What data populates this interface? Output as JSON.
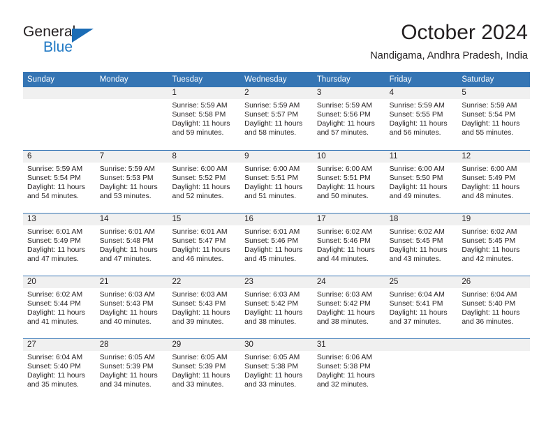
{
  "brand": {
    "name_top": "General",
    "name_bottom": "Blue",
    "triangle_color": "#1b6cb5",
    "blue_color": "#2079c4"
  },
  "header": {
    "title": "October 2024",
    "subtitle": "Nandigama, Andhra Pradesh, India"
  },
  "theme": {
    "header_row_bg": "#3575b4",
    "day_number_bg": "#f0f0f0",
    "text_color": "#231f20",
    "page_bg": "#ffffff"
  },
  "calendar": {
    "weekday_headers": [
      "Sunday",
      "Monday",
      "Tuesday",
      "Wednesday",
      "Thursday",
      "Friday",
      "Saturday"
    ],
    "weeks": [
      [
        {
          "day": "",
          "sunrise": "",
          "sunset": "",
          "daylight_line1": "",
          "daylight_line2": ""
        },
        {
          "day": "",
          "sunrise": "",
          "sunset": "",
          "daylight_line1": "",
          "daylight_line2": ""
        },
        {
          "day": "1",
          "sunrise": "Sunrise: 5:59 AM",
          "sunset": "Sunset: 5:58 PM",
          "daylight_line1": "Daylight: 11 hours",
          "daylight_line2": "and 59 minutes."
        },
        {
          "day": "2",
          "sunrise": "Sunrise: 5:59 AM",
          "sunset": "Sunset: 5:57 PM",
          "daylight_line1": "Daylight: 11 hours",
          "daylight_line2": "and 58 minutes."
        },
        {
          "day": "3",
          "sunrise": "Sunrise: 5:59 AM",
          "sunset": "Sunset: 5:56 PM",
          "daylight_line1": "Daylight: 11 hours",
          "daylight_line2": "and 57 minutes."
        },
        {
          "day": "4",
          "sunrise": "Sunrise: 5:59 AM",
          "sunset": "Sunset: 5:55 PM",
          "daylight_line1": "Daylight: 11 hours",
          "daylight_line2": "and 56 minutes."
        },
        {
          "day": "5",
          "sunrise": "Sunrise: 5:59 AM",
          "sunset": "Sunset: 5:54 PM",
          "daylight_line1": "Daylight: 11 hours",
          "daylight_line2": "and 55 minutes."
        }
      ],
      [
        {
          "day": "6",
          "sunrise": "Sunrise: 5:59 AM",
          "sunset": "Sunset: 5:54 PM",
          "daylight_line1": "Daylight: 11 hours",
          "daylight_line2": "and 54 minutes."
        },
        {
          "day": "7",
          "sunrise": "Sunrise: 5:59 AM",
          "sunset": "Sunset: 5:53 PM",
          "daylight_line1": "Daylight: 11 hours",
          "daylight_line2": "and 53 minutes."
        },
        {
          "day": "8",
          "sunrise": "Sunrise: 6:00 AM",
          "sunset": "Sunset: 5:52 PM",
          "daylight_line1": "Daylight: 11 hours",
          "daylight_line2": "and 52 minutes."
        },
        {
          "day": "9",
          "sunrise": "Sunrise: 6:00 AM",
          "sunset": "Sunset: 5:51 PM",
          "daylight_line1": "Daylight: 11 hours",
          "daylight_line2": "and 51 minutes."
        },
        {
          "day": "10",
          "sunrise": "Sunrise: 6:00 AM",
          "sunset": "Sunset: 5:51 PM",
          "daylight_line1": "Daylight: 11 hours",
          "daylight_line2": "and 50 minutes."
        },
        {
          "day": "11",
          "sunrise": "Sunrise: 6:00 AM",
          "sunset": "Sunset: 5:50 PM",
          "daylight_line1": "Daylight: 11 hours",
          "daylight_line2": "and 49 minutes."
        },
        {
          "day": "12",
          "sunrise": "Sunrise: 6:00 AM",
          "sunset": "Sunset: 5:49 PM",
          "daylight_line1": "Daylight: 11 hours",
          "daylight_line2": "and 48 minutes."
        }
      ],
      [
        {
          "day": "13",
          "sunrise": "Sunrise: 6:01 AM",
          "sunset": "Sunset: 5:49 PM",
          "daylight_line1": "Daylight: 11 hours",
          "daylight_line2": "and 47 minutes."
        },
        {
          "day": "14",
          "sunrise": "Sunrise: 6:01 AM",
          "sunset": "Sunset: 5:48 PM",
          "daylight_line1": "Daylight: 11 hours",
          "daylight_line2": "and 47 minutes."
        },
        {
          "day": "15",
          "sunrise": "Sunrise: 6:01 AM",
          "sunset": "Sunset: 5:47 PM",
          "daylight_line1": "Daylight: 11 hours",
          "daylight_line2": "and 46 minutes."
        },
        {
          "day": "16",
          "sunrise": "Sunrise: 6:01 AM",
          "sunset": "Sunset: 5:46 PM",
          "daylight_line1": "Daylight: 11 hours",
          "daylight_line2": "and 45 minutes."
        },
        {
          "day": "17",
          "sunrise": "Sunrise: 6:02 AM",
          "sunset": "Sunset: 5:46 PM",
          "daylight_line1": "Daylight: 11 hours",
          "daylight_line2": "and 44 minutes."
        },
        {
          "day": "18",
          "sunrise": "Sunrise: 6:02 AM",
          "sunset": "Sunset: 5:45 PM",
          "daylight_line1": "Daylight: 11 hours",
          "daylight_line2": "and 43 minutes."
        },
        {
          "day": "19",
          "sunrise": "Sunrise: 6:02 AM",
          "sunset": "Sunset: 5:45 PM",
          "daylight_line1": "Daylight: 11 hours",
          "daylight_line2": "and 42 minutes."
        }
      ],
      [
        {
          "day": "20",
          "sunrise": "Sunrise: 6:02 AM",
          "sunset": "Sunset: 5:44 PM",
          "daylight_line1": "Daylight: 11 hours",
          "daylight_line2": "and 41 minutes."
        },
        {
          "day": "21",
          "sunrise": "Sunrise: 6:03 AM",
          "sunset": "Sunset: 5:43 PM",
          "daylight_line1": "Daylight: 11 hours",
          "daylight_line2": "and 40 minutes."
        },
        {
          "day": "22",
          "sunrise": "Sunrise: 6:03 AM",
          "sunset": "Sunset: 5:43 PM",
          "daylight_line1": "Daylight: 11 hours",
          "daylight_line2": "and 39 minutes."
        },
        {
          "day": "23",
          "sunrise": "Sunrise: 6:03 AM",
          "sunset": "Sunset: 5:42 PM",
          "daylight_line1": "Daylight: 11 hours",
          "daylight_line2": "and 38 minutes."
        },
        {
          "day": "24",
          "sunrise": "Sunrise: 6:03 AM",
          "sunset": "Sunset: 5:42 PM",
          "daylight_line1": "Daylight: 11 hours",
          "daylight_line2": "and 38 minutes."
        },
        {
          "day": "25",
          "sunrise": "Sunrise: 6:04 AM",
          "sunset": "Sunset: 5:41 PM",
          "daylight_line1": "Daylight: 11 hours",
          "daylight_line2": "and 37 minutes."
        },
        {
          "day": "26",
          "sunrise": "Sunrise: 6:04 AM",
          "sunset": "Sunset: 5:40 PM",
          "daylight_line1": "Daylight: 11 hours",
          "daylight_line2": "and 36 minutes."
        }
      ],
      [
        {
          "day": "27",
          "sunrise": "Sunrise: 6:04 AM",
          "sunset": "Sunset: 5:40 PM",
          "daylight_line1": "Daylight: 11 hours",
          "daylight_line2": "and 35 minutes."
        },
        {
          "day": "28",
          "sunrise": "Sunrise: 6:05 AM",
          "sunset": "Sunset: 5:39 PM",
          "daylight_line1": "Daylight: 11 hours",
          "daylight_line2": "and 34 minutes."
        },
        {
          "day": "29",
          "sunrise": "Sunrise: 6:05 AM",
          "sunset": "Sunset: 5:39 PM",
          "daylight_line1": "Daylight: 11 hours",
          "daylight_line2": "and 33 minutes."
        },
        {
          "day": "30",
          "sunrise": "Sunrise: 6:05 AM",
          "sunset": "Sunset: 5:38 PM",
          "daylight_line1": "Daylight: 11 hours",
          "daylight_line2": "and 33 minutes."
        },
        {
          "day": "31",
          "sunrise": "Sunrise: 6:06 AM",
          "sunset": "Sunset: 5:38 PM",
          "daylight_line1": "Daylight: 11 hours",
          "daylight_line2": "and 32 minutes."
        },
        {
          "day": "",
          "sunrise": "",
          "sunset": "",
          "daylight_line1": "",
          "daylight_line2": ""
        },
        {
          "day": "",
          "sunrise": "",
          "sunset": "",
          "daylight_line1": "",
          "daylight_line2": ""
        }
      ]
    ]
  }
}
